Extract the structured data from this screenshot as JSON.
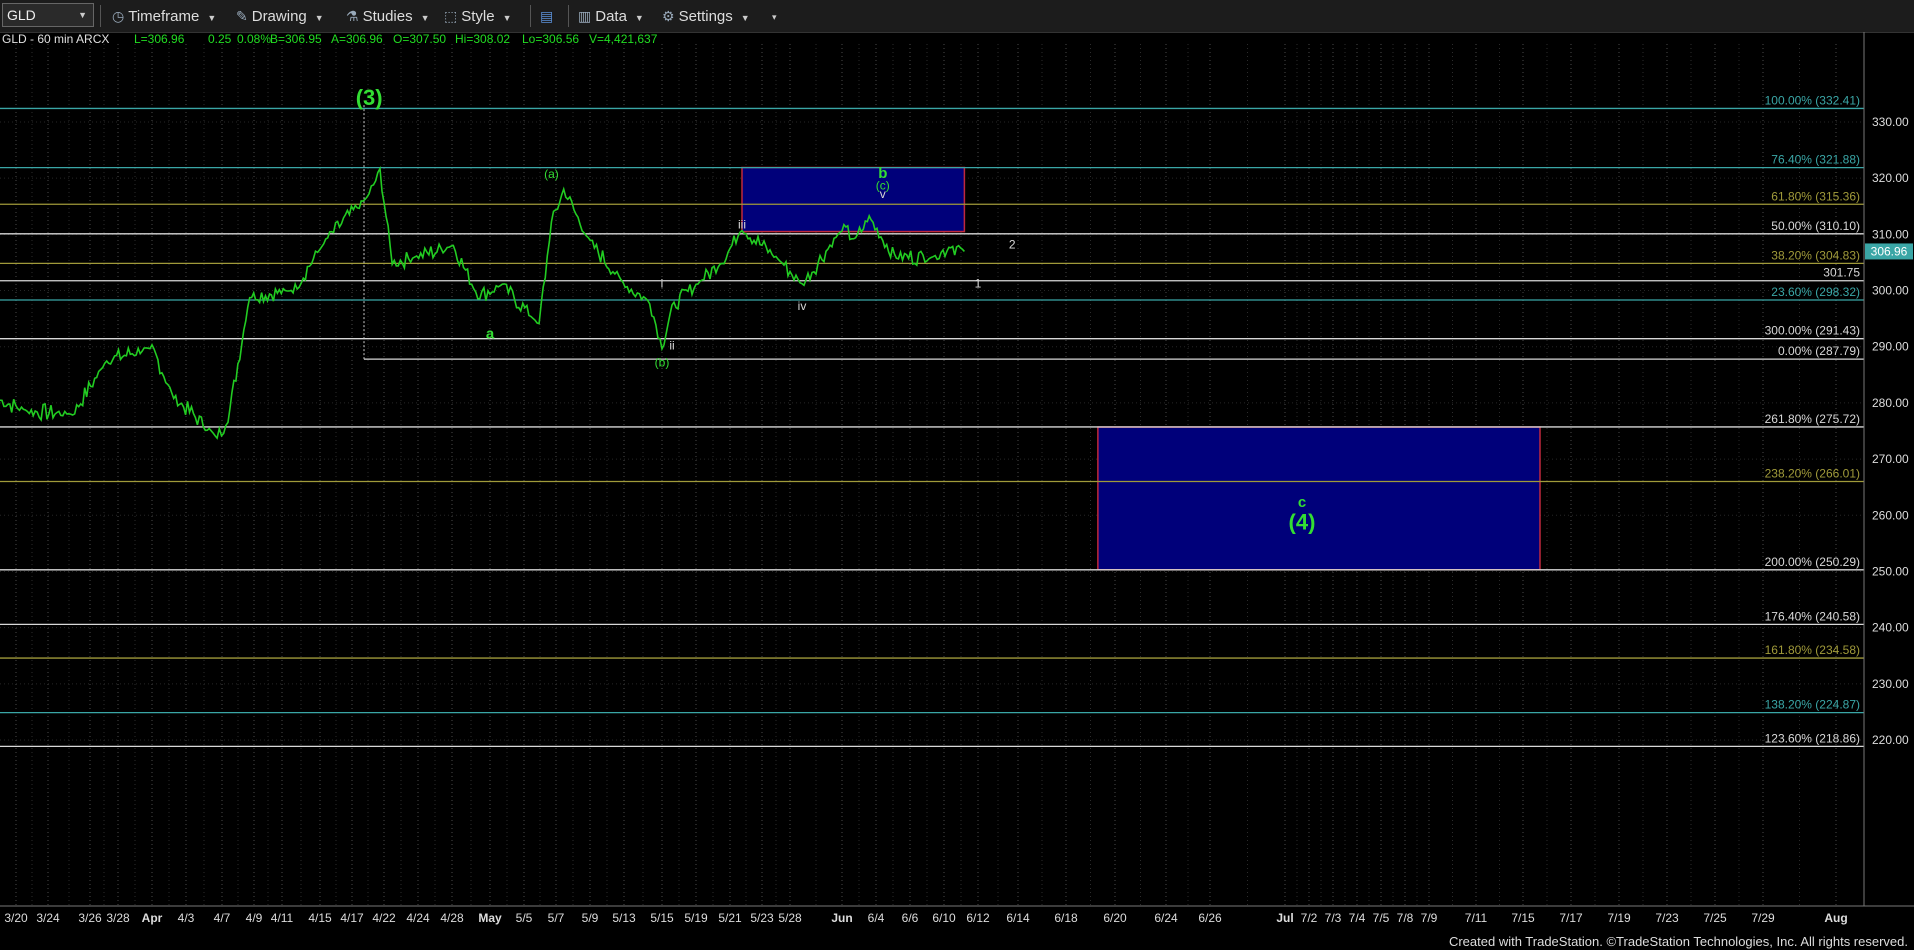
{
  "toolbar": {
    "symbol": "GLD",
    "timeframe_label": "Timeframe",
    "drawing_label": "Drawing",
    "studies_label": "Studies",
    "style_label": "Style",
    "data_label": "Data",
    "settings_label": "Settings",
    "icons": [
      "timeframe-icon",
      "drawing-icon",
      "studies-icon",
      "style-icon",
      "layout-icon",
      "data-icon",
      "settings-icon"
    ]
  },
  "header": {
    "quote": "GLD - 60 min  ARCX",
    "last": "L=306.96",
    "chg": "0.25",
    "pct": "0.08%",
    "bid": "B=306.95",
    "ask": "A=306.96",
    "open": "O=307.50",
    "high": "Hi=308.02",
    "low": "Lo=306.56",
    "vol": "V=4,421,637"
  },
  "colors": {
    "background": "#000000",
    "price_line": "#22cc22",
    "wave_label": "#33dd33",
    "grid": "#4a4a4a",
    "fib_white": "#d8d8d8",
    "fib_teal": "#3aa6a6",
    "fib_olive": "#a09a3a",
    "box_fill": "#00007a",
    "box_border": "#c0283c",
    "last_price_bg": "#3aa6a6"
  },
  "chart_data": {
    "type": "line",
    "title": "GLD - 60 min",
    "ylim": [
      212,
      336
    ],
    "y_ticks": [
      220,
      230,
      240,
      250,
      260,
      270,
      280,
      290,
      300,
      310,
      320,
      330
    ],
    "x_ticks": [
      "3/20",
      "3/24",
      "3/26",
      "3/28",
      "Apr",
      "4/3",
      "4/7",
      "4/9",
      "4/11",
      "4/15",
      "4/17",
      "4/22",
      "4/24",
      "4/28",
      "May",
      "5/5",
      "5/7",
      "5/9",
      "5/13",
      "5/15",
      "5/19",
      "5/21",
      "5/23",
      "5/28",
      "Jun",
      "6/4",
      "6/6",
      "6/10",
      "6/12",
      "6/14",
      "6/18",
      "6/20",
      "6/24",
      "6/26",
      "Jul",
      "7/2",
      "7/3",
      "7/4",
      "7/5",
      "7/8",
      "7/9",
      "7/11",
      "7/15",
      "7/17",
      "7/19",
      "7/23",
      "7/25",
      "7/29",
      "Aug"
    ],
    "x": [
      "3/18",
      "3/21",
      "3/25",
      "3/28",
      "4/1",
      "4/3",
      "4/7",
      "4/8",
      "4/10",
      "4/14",
      "4/17",
      "4/21",
      "4/22",
      "4/23",
      "4/25",
      "4/28",
      "4/30",
      "5/2",
      "5/5",
      "5/6",
      "5/7",
      "5/9",
      "5/12",
      "5/14",
      "5/15",
      "5/16",
      "5/19",
      "5/21",
      "5/23",
      "5/27",
      "5/29",
      "6/2",
      "6/3",
      "6/4",
      "6/5",
      "6/6",
      "6/9",
      "6/10",
      "6/11"
    ],
    "series": [
      {
        "values": [
          280.5,
          278.5,
          278,
          287.5,
          290,
          281,
          274,
          277,
          299,
          300,
          309,
          317,
          321.5,
          305,
          306,
          308,
          299,
          301,
          294,
          312,
          318,
          309,
          301,
          298,
          290,
          297,
          302,
          305,
          311,
          305,
          301,
          311,
          309,
          313,
          309,
          306,
          306,
          308,
          306.96
        ]
      }
    ],
    "last_price": "306.96",
    "price_levels": [
      {
        "label": "100.00% (332.41)",
        "value": 332.41,
        "color": "teal"
      },
      {
        "label": "76.40% (321.88)",
        "value": 321.88,
        "color": "teal"
      },
      {
        "label": "61.80% (315.36)",
        "value": 315.36,
        "color": "olive"
      },
      {
        "label": "50.00% (310.10)",
        "value": 310.1,
        "color": "white"
      },
      {
        "label": "38.20% (304.83)",
        "value": 304.83,
        "color": "olive"
      },
      {
        "label": "301.75",
        "value": 301.75,
        "color": "white"
      },
      {
        "label": "23.60% (298.32)",
        "value": 298.32,
        "color": "teal"
      },
      {
        "label": "300.00% (291.43)",
        "value": 291.43,
        "color": "white"
      },
      {
        "label": "0.00% (287.79)",
        "value": 287.79,
        "color": "white"
      },
      {
        "label": "261.80% (275.72)",
        "value": 275.72,
        "color": "white"
      },
      {
        "label": "238.20% (266.01)",
        "value": 266.01,
        "color": "olive"
      },
      {
        "label": "200.00% (250.29)",
        "value": 250.29,
        "color": "white"
      },
      {
        "label": "176.40% (240.58)",
        "value": 240.58,
        "color": "white"
      },
      {
        "label": "161.80% (234.58)",
        "value": 234.58,
        "color": "olive"
      },
      {
        "label": "138.20% (224.87)",
        "value": 224.87,
        "color": "teal"
      },
      {
        "label": "123.60% (218.86)",
        "value": 218.86,
        "color": "white"
      }
    ],
    "target_boxes": [
      {
        "x_from": "5/23",
        "x_to": "6/11",
        "y_from": 310.5,
        "y_to": 321.9
      },
      {
        "x_from": "6/19",
        "x_to": "7/16",
        "y_from": 250.3,
        "y_to": 275.7
      }
    ],
    "wave_labels": [
      {
        "text": "(3)",
        "x": "4/21",
        "y": 333,
        "color": "green",
        "size": "large"
      },
      {
        "text": "a",
        "x": "5/1",
        "y": 291.5,
        "color": "green",
        "size": "normal"
      },
      {
        "text": "(a)",
        "x": "5/6",
        "y": 320,
        "color": "green",
        "size": "small"
      },
      {
        "text": "(b)",
        "x": "5/15",
        "y": 286.5,
        "color": "green",
        "size": "small"
      },
      {
        "text": "b",
        "x": "6/5",
        "y": 320,
        "color": "green",
        "size": "normal"
      },
      {
        "text": "(c)",
        "x": "6/5",
        "y": 318,
        "color": "green",
        "size": "small"
      },
      {
        "text": "i",
        "x": "5/15",
        "y": 300.5,
        "color": "white",
        "size": "small"
      },
      {
        "text": "ii",
        "x": "5/16",
        "y": 289.5,
        "color": "white",
        "size": "small"
      },
      {
        "text": "iii",
        "x": "5/23",
        "y": 311,
        "color": "white",
        "size": "small"
      },
      {
        "text": "iv",
        "x": "5/29",
        "y": 296.5,
        "color": "white",
        "size": "small"
      },
      {
        "text": "v",
        "x": "6/5",
        "y": 316.5,
        "color": "white",
        "size": "small"
      },
      {
        "text": "1",
        "x": "6/12",
        "y": 300.5,
        "color": "white",
        "size": "small"
      },
      {
        "text": "2",
        "x": "6/14",
        "y": 307.5,
        "color": "white",
        "size": "small"
      },
      {
        "text": "c",
        "x": "7/2",
        "y": 261.5,
        "color": "green",
        "size": "normal"
      },
      {
        "text": "(4)",
        "x": "7/2",
        "y": 257.5,
        "color": "green",
        "size": "large"
      }
    ]
  },
  "footer": {
    "credit": "Created with TradeStation. ©TradeStation Technologies, Inc. All rights reserved."
  }
}
